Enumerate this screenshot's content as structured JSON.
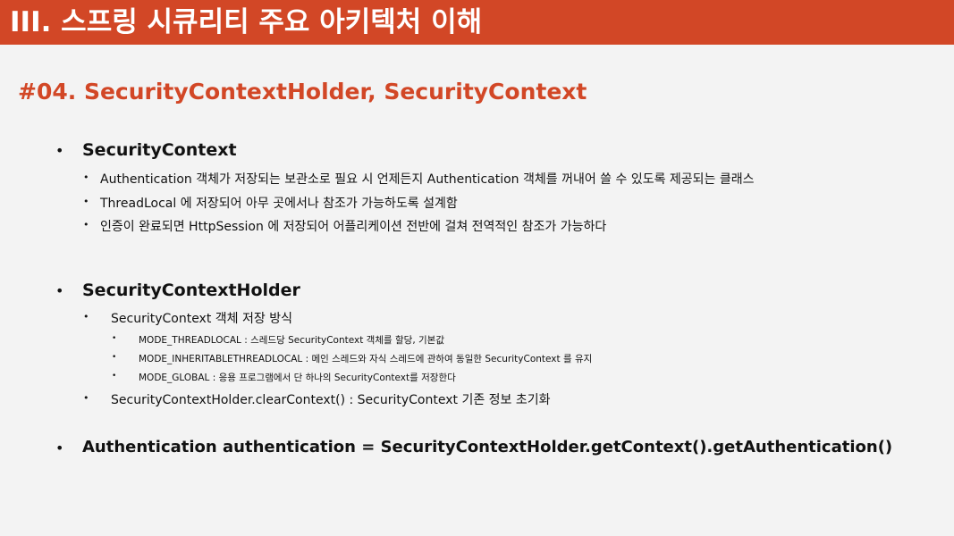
{
  "slide": {
    "title": "III. 스프링 시큐리티 주요 아키텍처 이해",
    "subtitle": "#04. SecurityContextHolder, SecurityContext"
  },
  "bullet_char": "•",
  "sections": {
    "security_context": {
      "heading": "SecurityContext",
      "items": [
        "Authentication 객체가 저장되는 보관소로 필요 시 언제든지 Authentication 객체를 꺼내어 쓸 수 있도록 제공되는 클래스",
        "ThreadLocal 에 저장되어 아무 곳에서나 참조가 가능하도록 설계함",
        "인증이 완료되면 HttpSession 에 저장되어 어플리케이션 전반에 걸쳐 전역적인 참조가 가능하다"
      ]
    },
    "holder": {
      "heading": "SecurityContextHolder",
      "storage_label": "SecurityContext 객체 저장 방식",
      "modes": [
        "MODE_THREADLOCAL : 스레드당 SecurityContext 객체를 할당, 기본값",
        "MODE_INHERITABLETHREADLOCAL : 메인 스레드와 자식 스레드에 관하여 동일한 SecurityContext 를 유지",
        "MODE_GLOBAL :  응용 프로그램에서 단 하나의 SecurityContext를 저장한다"
      ],
      "clear_context": "SecurityContextHolder.clearContext() : SecurityContext 기존 정보 초기화"
    },
    "code_line": "Authentication authentication = SecurityContextHolder.getContext().getAuthentication()"
  }
}
